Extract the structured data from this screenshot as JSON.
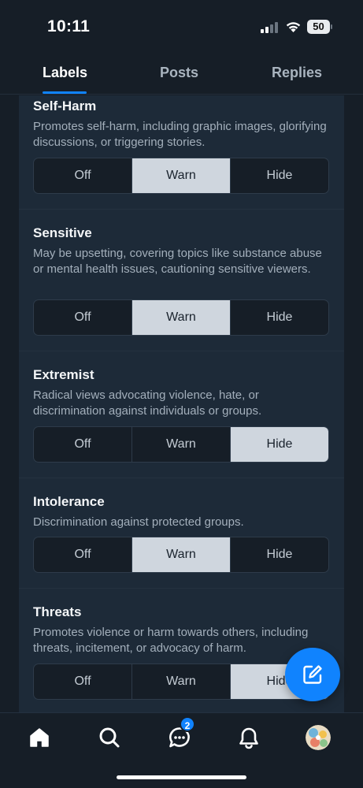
{
  "status_bar": {
    "time": "10:11",
    "battery": "50"
  },
  "tabs": [
    {
      "label": "Labels",
      "active": true
    },
    {
      "label": "Posts",
      "active": false
    },
    {
      "label": "Replies",
      "active": false
    }
  ],
  "labels": [
    {
      "title": "Self-Harm",
      "description": "Promotes self-harm, including graphic images, glorifying discussions, or triggering stories.",
      "options": [
        "Off",
        "Warn",
        "Hide"
      ],
      "selected": "Warn"
    },
    {
      "title": "Sensitive",
      "description": "May be upsetting, covering topics like substance abuse or mental health issues, cautioning sensitive viewers.",
      "options": [
        "Off",
        "Warn",
        "Hide"
      ],
      "selected": "Warn"
    },
    {
      "title": "Extremist",
      "description": "Radical views advocating violence, hate, or discrimination against individuals or groups.",
      "options": [
        "Off",
        "Warn",
        "Hide"
      ],
      "selected": "Hide"
    },
    {
      "title": "Intolerance",
      "description": "Discrimination against protected groups.",
      "options": [
        "Off",
        "Warn",
        "Hide"
      ],
      "selected": "Warn"
    },
    {
      "title": "Threats",
      "description": "Promotes violence or harm towards others, including threats, incitement, or advocacy of harm.",
      "options": [
        "Off",
        "Warn",
        "Hide"
      ],
      "selected": "Hide"
    }
  ],
  "fab": {
    "icon": "compose-icon"
  },
  "bottom_nav": {
    "items": [
      {
        "icon": "home-icon"
      },
      {
        "icon": "search-icon"
      },
      {
        "icon": "chat-icon",
        "badge": "2"
      },
      {
        "icon": "bell-icon"
      },
      {
        "icon": "avatar"
      }
    ]
  },
  "colors": {
    "accent": "#1083fe",
    "background": "#161e27",
    "panel": "#1d2a38",
    "selected_segment": "#cfd6de"
  }
}
